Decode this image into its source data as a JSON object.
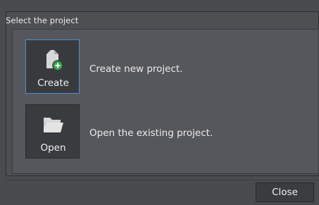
{
  "dialog": {
    "group_title": "Select the project",
    "options": [
      {
        "tile_label": "Create",
        "description": "Create new project.",
        "icon": "new-document-plus-icon"
      },
      {
        "tile_label": "Open",
        "description": "Open the existing project.",
        "icon": "folder-open-icon"
      }
    ],
    "close_label": "Close"
  },
  "colors": {
    "background": "#4a4b4f",
    "tile": "#3a3b3e",
    "selected_border": "#4c8fd0",
    "accent_green": "#2fa845"
  }
}
